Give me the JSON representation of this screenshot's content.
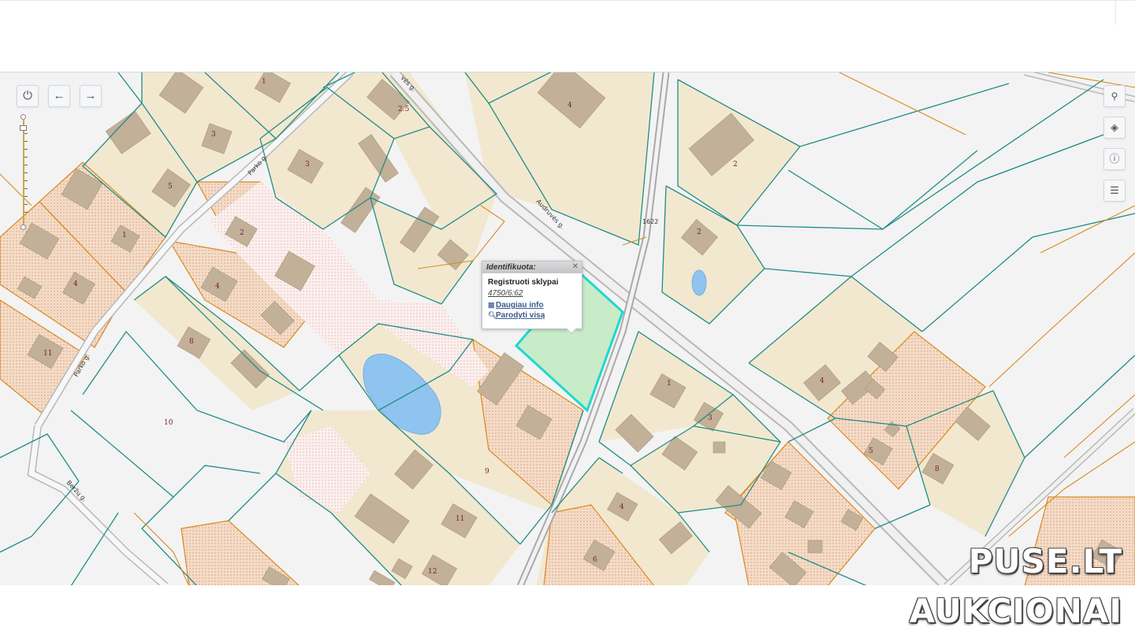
{
  "map": {
    "parcel_numbers": [
      "1",
      "2.5",
      "4",
      "2",
      "3",
      "5",
      "3",
      "2",
      "1",
      "2",
      "4",
      "4",
      "8",
      "11",
      "1622",
      "10",
      "9",
      "11",
      "12",
      "1",
      "3",
      "4",
      "5",
      "6",
      "4",
      "8"
    ],
    "roads": [
      "Parko g.",
      "Audruvės g.",
      "Parko g.",
      "Beržų g."
    ],
    "colors": {
      "parcel_fill": "#f2e8cf",
      "private_fill": "#f3d9bf",
      "teal_line": "#1f8d86",
      "orange_line": "#d98a1c",
      "selected": "#21d7d0",
      "selected_fill": "#c8ebc8",
      "water": "#8fc4f0",
      "building": "#c2b098"
    }
  },
  "toolbar": {
    "power_icon": "power-icon",
    "back_icon": "arrow-left-icon",
    "forward_icon": "arrow-right-icon"
  },
  "right_tools": [
    "search-icon",
    "layers-icon",
    "info-icon",
    "document-icon"
  ],
  "popup": {
    "header": "Identifikuota:",
    "title": "Registruoti sklypai",
    "code": "4750/6:62",
    "more_info": "Daugiau info",
    "show_all": "Parodyti visą"
  },
  "watermark": {
    "line1": "PUSE.LT",
    "line2": "AUKCIONAI"
  }
}
